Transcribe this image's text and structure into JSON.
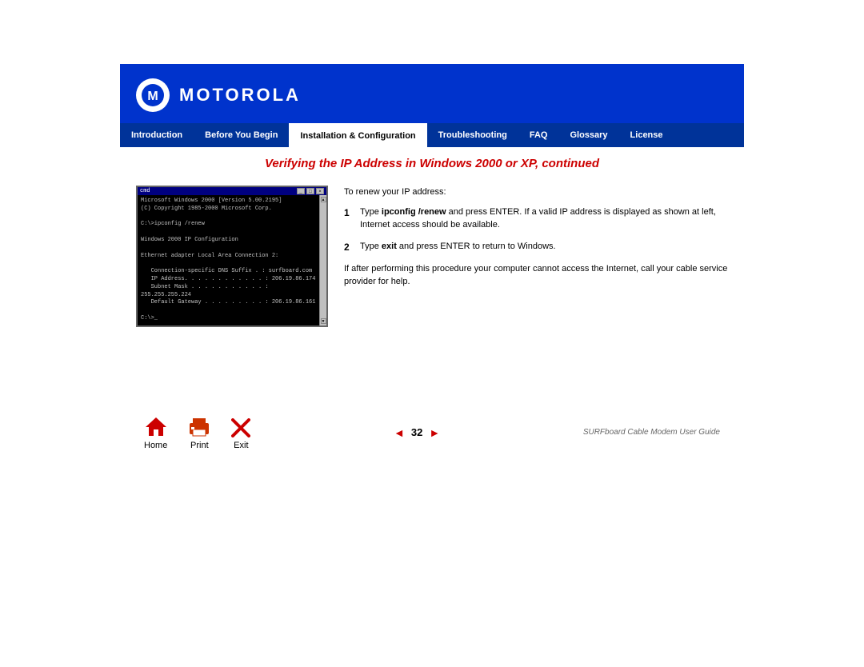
{
  "header": {
    "logo_text": "MOTOROLA",
    "background_color": "#0033cc"
  },
  "nav": {
    "items": [
      {
        "id": "introduction",
        "label": "Introduction",
        "active": false
      },
      {
        "id": "before-you-begin",
        "label": "Before You Begin",
        "active": false
      },
      {
        "id": "installation-configuration",
        "label": "Installation & Configuration",
        "active": true
      },
      {
        "id": "troubleshooting",
        "label": "Troubleshooting",
        "active": false
      },
      {
        "id": "faq",
        "label": "FAQ",
        "active": false
      },
      {
        "id": "glossary",
        "label": "Glossary",
        "active": false
      },
      {
        "id": "license",
        "label": "License",
        "active": false
      }
    ]
  },
  "page": {
    "title": "Verifying the IP Address in Windows  2000 or XP, continued",
    "subtitle": "To renew your IP address:"
  },
  "cmd_window": {
    "title": "cmd",
    "lines": [
      "Microsoft Windows 2000 [Version 5.00.2195]",
      "(C) Copyright 1985-2000 Microsoft Corp.",
      "",
      "C:\\>ipconfig /renew",
      "",
      "Windows 2000 IP Configuration",
      "",
      "Ethernet adapter Local Area Connection 2:",
      "",
      "   Connection-specific DNS Suffix  . : surfboard.com",
      "   IP Address. . . . . . . . . . . . : 206.19.86.174",
      "   Subnet Mask . . . . . . . . . . . : 255.255.255.224",
      "   Default Gateway . . . . . . . . . : 206.19.86.161",
      "",
      "C:\\>_"
    ]
  },
  "steps": [
    {
      "number": "1",
      "text_before": "Type ",
      "bold": "ipconfig /renew",
      "text_after": " and press ENTER. If a valid IP address is displayed as shown at left, Internet access should be available."
    },
    {
      "number": "2",
      "text_before": "Type ",
      "bold": "exit",
      "text_after": " and press ENTER to return to Windows."
    }
  ],
  "note_text": "If after performing this procedure your computer cannot access the Internet, call your cable service provider for help.",
  "footer": {
    "home_label": "Home",
    "print_label": "Print",
    "exit_label": "Exit",
    "page_number": "32",
    "guide_title": "SURFboard Cable Modem User Guide"
  }
}
